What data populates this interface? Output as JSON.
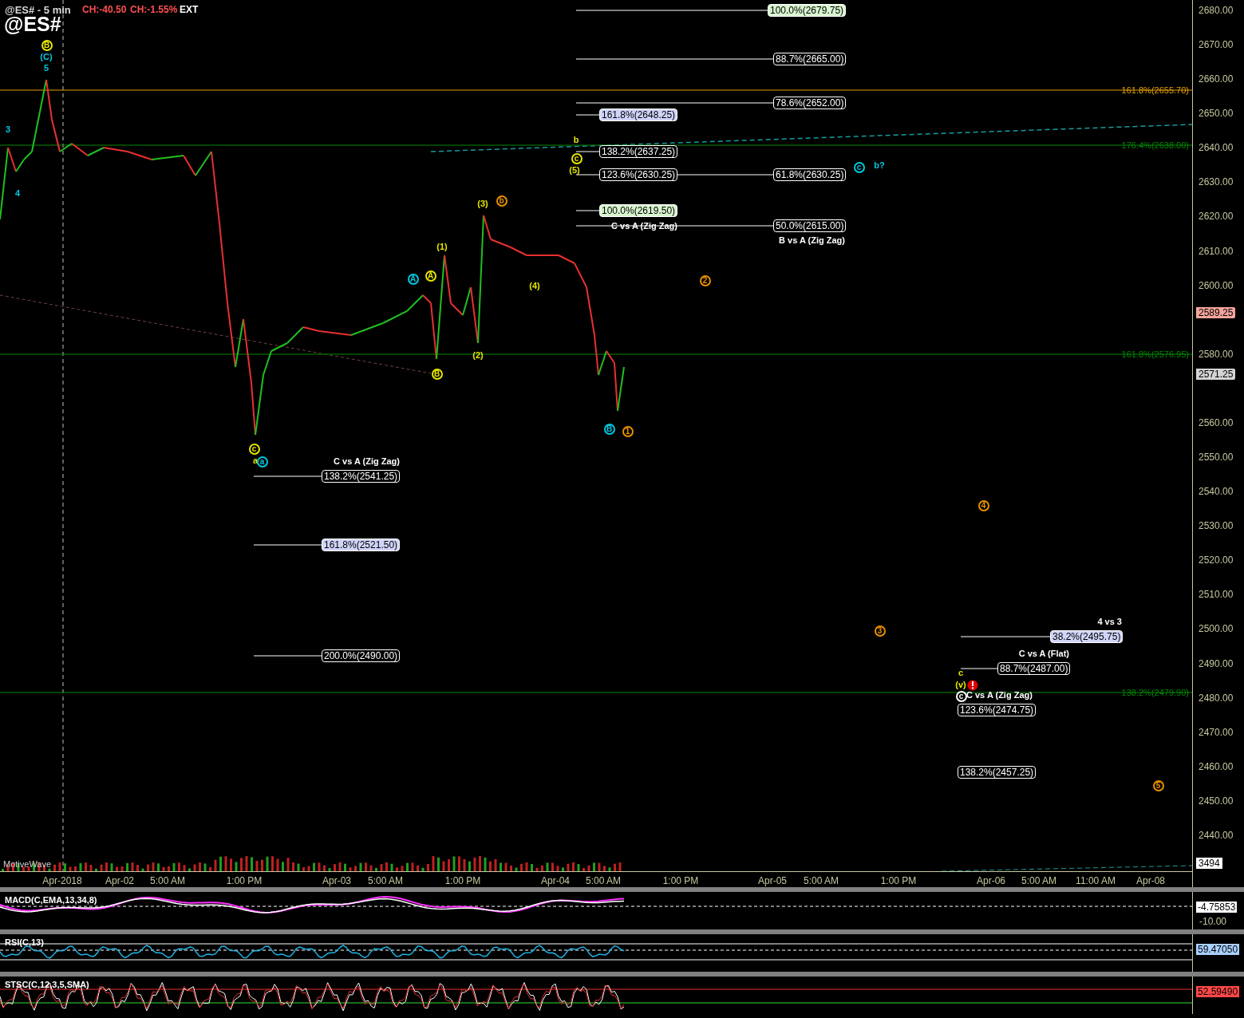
{
  "header": {
    "title": "@ES# - 5 min",
    "change": "CH:-40.50",
    "change_percent": "CH:-1.55%",
    "session": "EXT",
    "symbol": "@ES#"
  },
  "level_lines": [
    {
      "label": "161.8%(2655.70)",
      "color": "#e8a000"
    },
    {
      "label": "176.4%(2638.00)",
      "color": "#008a00"
    },
    {
      "label": "161.8%(2576.95)",
      "color": "#008a00"
    },
    {
      "label": "138.2%(2479.90)",
      "color": "#008a00"
    }
  ],
  "fib_levels": [
    {
      "label": "100.0%(2679.75)",
      "kind": "green"
    },
    {
      "label": "88.7%(2665.00)",
      "kind": "plain"
    },
    {
      "label": "78.6%(2652.00)",
      "kind": "plain"
    },
    {
      "label": "161.8%(2648.25)",
      "kind": "blue"
    },
    {
      "label": "138.2%(2637.25)",
      "kind": "plain"
    },
    {
      "label": "123.6%(2630.25)",
      "kind": "plain"
    },
    {
      "label": "61.8%(2630.25)",
      "kind": "plain"
    },
    {
      "label": "100.0%(2619.50)",
      "kind": "green"
    },
    {
      "label": "50.0%(2615.00)",
      "kind": "plain"
    },
    {
      "label": "138.2%(2541.25)",
      "kind": "plain"
    },
    {
      "label": "161.8%(2521.50)",
      "kind": "blue"
    },
    {
      "label": "200.0%(2490.00)",
      "kind": "plain"
    },
    {
      "label": "38.2%(2495.75)",
      "kind": "blue"
    },
    {
      "label": "88.7%(2487.00)",
      "kind": "plain"
    },
    {
      "label": "123.6%(2474.75)",
      "kind": "plain"
    },
    {
      "label": "138.2%(2457.25)",
      "kind": "plain"
    }
  ],
  "fib_titles": [
    "C vs A (Zig Zag)",
    "B vs A (Zig Zag)",
    "C vs A (Zig Zag)",
    "4 vs 3",
    "C vs A (Flat)",
    "C vs A (Zig Zag)"
  ],
  "wave_labels": [
    {
      "text": "B",
      "circled": true,
      "color": "#e6e600"
    },
    {
      "text": "(C)",
      "circled": false,
      "color": "#00c8e0"
    },
    {
      "text": "5",
      "circled": false,
      "color": "#00c8e0"
    },
    {
      "text": "3",
      "circled": false,
      "color": "#00c8e0"
    },
    {
      "text": "4",
      "circled": false,
      "color": "#00c8e0"
    },
    {
      "text": "c",
      "circled": true,
      "color": "#e6e600"
    },
    {
      "text": "a",
      "circled": false,
      "color": "#e6e600"
    },
    {
      "text": "a",
      "circled": true,
      "color": "#00c8e0"
    },
    {
      "text": "A",
      "circled": true,
      "color": "#00c8e0"
    },
    {
      "text": "A",
      "circled": true,
      "color": "#e6e600"
    },
    {
      "text": "(1)",
      "circled": false,
      "color": "#e6e600"
    },
    {
      "text": "B",
      "circled": true,
      "color": "#e6e600"
    },
    {
      "text": "(2)",
      "circled": false,
      "color": "#e6e600"
    },
    {
      "text": "(3)",
      "circled": false,
      "color": "#e6e600"
    },
    {
      "text": "b",
      "circled": true,
      "color": "#e89000"
    },
    {
      "text": "(4)",
      "circled": false,
      "color": "#e6e600"
    },
    {
      "text": "b",
      "circled": false,
      "color": "#e6e600"
    },
    {
      "text": "c",
      "circled": true,
      "color": "#e6e600"
    },
    {
      "text": "(5)",
      "circled": false,
      "color": "#e6e600"
    },
    {
      "text": "c",
      "circled": true,
      "color": "#00c8e0"
    },
    {
      "text": "b?",
      "circled": false,
      "color": "#00c8e0"
    },
    {
      "text": "2",
      "circled": true,
      "color": "#e89000"
    },
    {
      "text": "B",
      "circled": true,
      "color": "#00c8e0"
    },
    {
      "text": "1",
      "circled": true,
      "color": "#e89000"
    },
    {
      "text": "4",
      "circled": true,
      "color": "#e89000"
    },
    {
      "text": "3",
      "circled": true,
      "color": "#e89000"
    },
    {
      "text": "5",
      "circled": true,
      "color": "#e89000"
    },
    {
      "text": "c",
      "circled": false,
      "color": "#e6e600"
    },
    {
      "text": "(v)",
      "circled": false,
      "color": "#e6e600"
    },
    {
      "text": "c",
      "circled": true,
      "color": "#ffffff"
    }
  ],
  "source_label": "MotiveWave",
  "price_axis": {
    "ticks": [
      "2680.00",
      "2670.00",
      "2660.00",
      "2650.00",
      "2640.00",
      "2630.00",
      "2620.00",
      "2610.00",
      "2600.00",
      "2580.00",
      "2560.00",
      "2550.00",
      "2540.00",
      "2530.00",
      "2520.00",
      "2510.00",
      "2500.00",
      "2490.00",
      "2480.00",
      "2470.00",
      "2460.00",
      "2450.00",
      "2440.00"
    ],
    "tags": [
      {
        "label": "2589.25",
        "color": "#f4a59c"
      },
      {
        "label": "2571.25",
        "color": "#d4d4d4"
      }
    ]
  },
  "volume_tag": "3494",
  "time_axis": [
    "Apr-2018",
    "Apr-02",
    "5:00 AM",
    "1:00 PM",
    "Apr-03",
    "5:00 AM",
    "1:00 PM",
    "Apr-04",
    "5:00 AM",
    "1:00 PM",
    "Apr-05",
    "5:00 AM",
    "1:00 PM",
    "Apr-06",
    "5:00 AM",
    "11:00 AM",
    "Apr-08"
  ],
  "indicators": [
    {
      "title": "MACD(C,EMA,13,34,8)",
      "ticks": [
        "-10.00"
      ],
      "tags": [
        {
          "label": "-4.75853",
          "color": "#ffffff"
        }
      ]
    },
    {
      "title": "RSI(C,13)",
      "tags": [
        {
          "label": "59.47050",
          "color": "#a8d0ff"
        }
      ]
    },
    {
      "title": "STSC(C,12,3,5,SMA)",
      "tags": [
        {
          "label": "52.59490",
          "color": "#ff4848"
        }
      ]
    }
  ]
}
